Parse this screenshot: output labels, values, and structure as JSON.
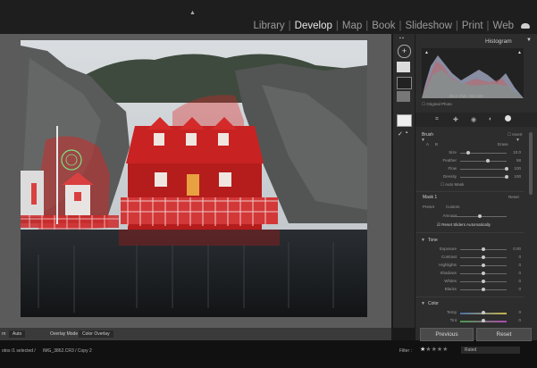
{
  "top_arrow": "▲",
  "modules": [
    {
      "label": "Library",
      "active": false
    },
    {
      "label": "Develop",
      "active": true
    },
    {
      "label": "Map",
      "active": false
    },
    {
      "label": "Book",
      "active": false
    },
    {
      "label": "Slideshow",
      "active": false
    },
    {
      "label": "Print",
      "active": false
    },
    {
      "label": "Web",
      "active": false
    }
  ],
  "histogram": {
    "title": "Histogram",
    "readout": [
      "56.3",
      "f/16",
      "ISO 100"
    ],
    "original_photo_label": "Original Photo"
  },
  "brush_panel": {
    "title": "Brush",
    "invert_label": "Invert",
    "a_label": "A",
    "b_label": "B",
    "erase_label": "Erase",
    "sliders": [
      {
        "label": "Size",
        "value": "10.0",
        "pos": 0.15
      },
      {
        "label": "Feather",
        "value": "58",
        "pos": 0.58
      },
      {
        "label": "Flow",
        "value": "100",
        "pos": 1.0
      },
      {
        "label": "Density",
        "value": "100",
        "pos": 1.0
      }
    ],
    "auto_mask_label": "Auto Mask"
  },
  "mask_panel": {
    "title": "Mask 1",
    "reset_label": "Reset",
    "preset_label": "Preset",
    "preset_value": "Custom",
    "amount_label": "Amount",
    "reset_sliders_label": "Reset Sliders Automatically"
  },
  "tone_panel": {
    "title": "Tone",
    "sliders": [
      {
        "label": "Exposure",
        "value": "0.00"
      },
      {
        "label": "Contrast",
        "value": "0"
      },
      {
        "label": "Highlights",
        "value": "0"
      },
      {
        "label": "Shadows",
        "value": "0"
      },
      {
        "label": "Whites",
        "value": "0"
      },
      {
        "label": "Blacks",
        "value": "0"
      }
    ]
  },
  "color_panel": {
    "title": "Color",
    "sliders": [
      {
        "label": "Temp",
        "value": "0"
      },
      {
        "label": "Tint",
        "value": "0"
      }
    ]
  },
  "buttons": {
    "previous": "Previous",
    "reset": "Reset"
  },
  "toolbar": {
    "show_label": "rn",
    "show_value": "Auto",
    "overlay_label": "Overlay Mode",
    "overlay_value": "Color Overlay"
  },
  "filmstrip": {
    "info": "otos /1 selected /",
    "filename": "IMG_3862.CR3 / Copy 2",
    "filter_label": "Filter :",
    "stars": [
      true,
      false,
      false,
      false,
      false
    ],
    "rated_label": "Rated"
  },
  "colors": {
    "accent": "#d9d9d9",
    "mask_overlay": "#e02020",
    "panel_bg": "#2d2d2d"
  }
}
